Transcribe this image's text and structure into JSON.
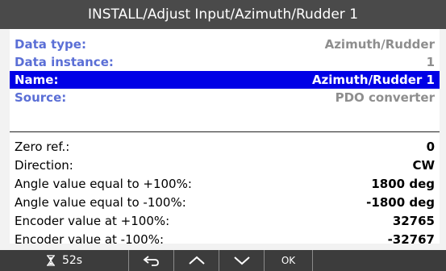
{
  "title": "INSTALL/Adjust Input/Azimuth/Rudder 1",
  "info_rows": [
    {
      "label": "Data type:",
      "value": "Azimuth/Rudder"
    },
    {
      "label": "Data instance:",
      "value": "1"
    },
    {
      "label": "Name:",
      "value": "Azimuth/Rudder 1",
      "selected": true
    },
    {
      "label": "Source:",
      "value": "PDO converter"
    }
  ],
  "param_rows": [
    {
      "label": "Zero ref.:",
      "value": "0"
    },
    {
      "label": "Direction:",
      "value": "CW"
    },
    {
      "label": "Angle value equal to +100%:",
      "value": "1800 deg"
    },
    {
      "label": "Angle value equal to -100%:",
      "value": "-1800 deg"
    },
    {
      "label": "Encoder value at +100%:",
      "value": "32765"
    },
    {
      "label": "Encoder value at -100%:",
      "value": "-32767"
    }
  ],
  "bottom_bar": {
    "timer_icon": "hourglass-icon",
    "timer_value": "52s",
    "buttons": [
      {
        "name": "back-button",
        "icon": "back-arrow-icon"
      },
      {
        "name": "up-button",
        "icon": "chevron-up-icon"
      },
      {
        "name": "down-button",
        "icon": "chevron-down-icon"
      },
      {
        "name": "ok-button",
        "label": "OK"
      }
    ]
  },
  "colors": {
    "title_bg": "#4a4a4a",
    "selected_bg": "#0000e6",
    "info_label": "#5b6fd6",
    "info_value": "#8e8e8e",
    "bottom_bar_bg": "#3c3c3c"
  }
}
